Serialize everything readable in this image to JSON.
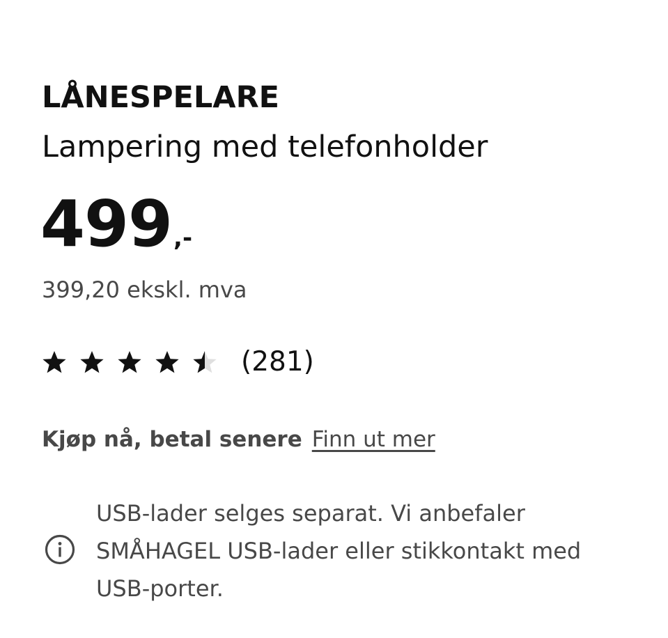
{
  "product": {
    "name": "LÅNESPELARE",
    "description": "Lampering med telefonholder"
  },
  "price": {
    "integer": "499",
    "suffix": ",-",
    "ex_vat": "399,20 ekskl. mva"
  },
  "rating": {
    "value": 4.5,
    "max": 5,
    "count_label": "(281)",
    "star_color": "#111111",
    "empty_star_color": "#dfdfdf"
  },
  "bnpl": {
    "label": "Kjøp nå, betal senere",
    "link": "Finn ut mer"
  },
  "info": {
    "icon": "info-circle-icon",
    "text": "USB-lader selges separat. Vi anbefaler SMÅHAGEL USB-lader eller stikkontakt med USB-porter."
  }
}
